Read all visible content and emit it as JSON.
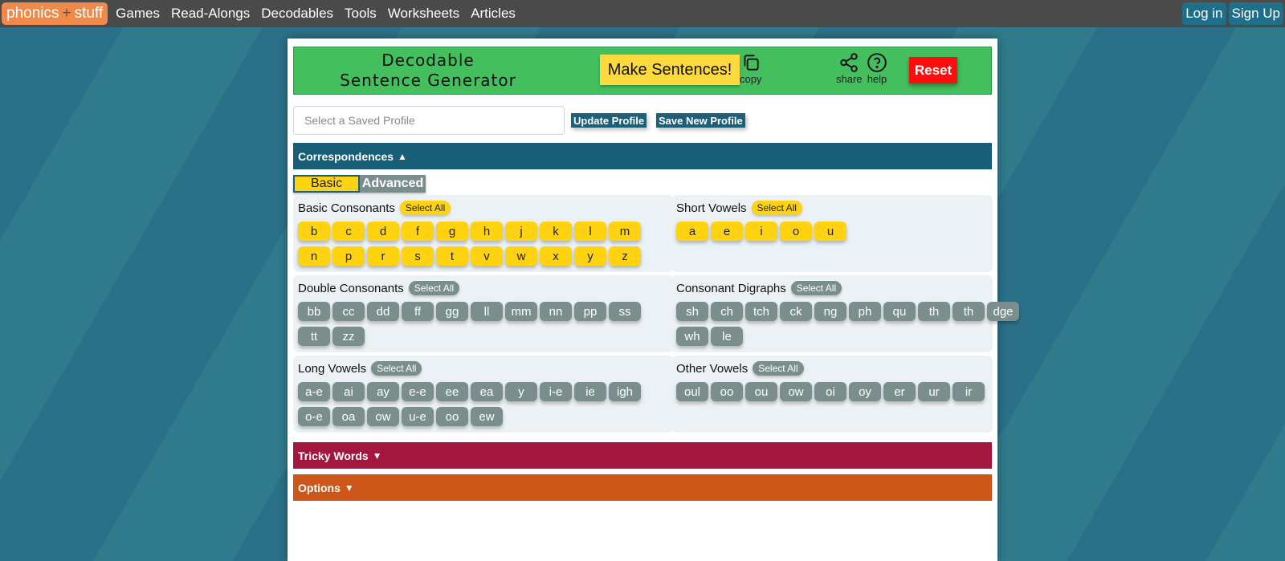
{
  "nav": {
    "logo_left": "phonics",
    "logo_plus": "+",
    "logo_right": "stuff",
    "links": [
      "Games",
      "Read-Alongs",
      "Decodables",
      "Tools",
      "Worksheets",
      "Articles"
    ],
    "login": "Log in",
    "signup": "Sign Up"
  },
  "header": {
    "title_line1": "Decodable",
    "title_line2": "Sentence Generator",
    "make_button": "Make Sentences!",
    "copy_label": "copy",
    "share_label": "share",
    "help_label": "help",
    "reset_label": "Reset"
  },
  "profile": {
    "placeholder": "Select a Saved Profile",
    "update_label": "Update Profile",
    "save_new_label": "Save New Profile"
  },
  "sections": {
    "correspondences": "Correspondences",
    "tricky_words": "Tricky Words",
    "options": "Options"
  },
  "toggle": {
    "basic": "Basic",
    "advanced": "Advanced",
    "selected": "Basic"
  },
  "select_all_label": "Select All",
  "groups": {
    "basic_consonants": {
      "title": "Basic Consonants",
      "items": [
        "b",
        "c",
        "d",
        "f",
        "g",
        "h",
        "j",
        "k",
        "l",
        "m",
        "n",
        "p",
        "r",
        "s",
        "t",
        "v",
        "w",
        "x",
        "y",
        "z"
      ]
    },
    "short_vowels": {
      "title": "Short Vowels",
      "items": [
        "a",
        "e",
        "i",
        "o",
        "u"
      ]
    },
    "double_consonants": {
      "title": "Double Consonants",
      "items": [
        "bb",
        "cc",
        "dd",
        "ff",
        "gg",
        "ll",
        "mm",
        "nn",
        "pp",
        "ss",
        "tt",
        "zz"
      ]
    },
    "consonant_digraphs": {
      "title": "Consonant Digraphs",
      "items": [
        "sh",
        "ch",
        "tch",
        "ck",
        "ng",
        "ph",
        "qu",
        "th",
        "th",
        "dge",
        "wh",
        "le"
      ]
    },
    "long_vowels": {
      "title": "Long Vowels",
      "items": [
        "a-e",
        "ai",
        "ay",
        "e-e",
        "ee",
        "ea",
        "y",
        "i-e",
        "ie",
        "igh",
        "o-e",
        "oa",
        "ow",
        "u-e",
        "oo",
        "ew"
      ]
    },
    "other_vowels": {
      "title": "Other Vowels",
      "items": [
        "oul",
        "oo",
        "ou",
        "ow",
        "oi",
        "oy",
        "er",
        "ur",
        "ir"
      ]
    }
  },
  "colors": {
    "header_green": "#43bf5e",
    "correspondences_bar": "#185e77",
    "tricky_bar": "#a3163f",
    "options_bar": "#cc5719",
    "selected_chip": "#ffd310",
    "unselected_chip": "#7b8e8e",
    "reset_red": "#ff0d0d"
  }
}
